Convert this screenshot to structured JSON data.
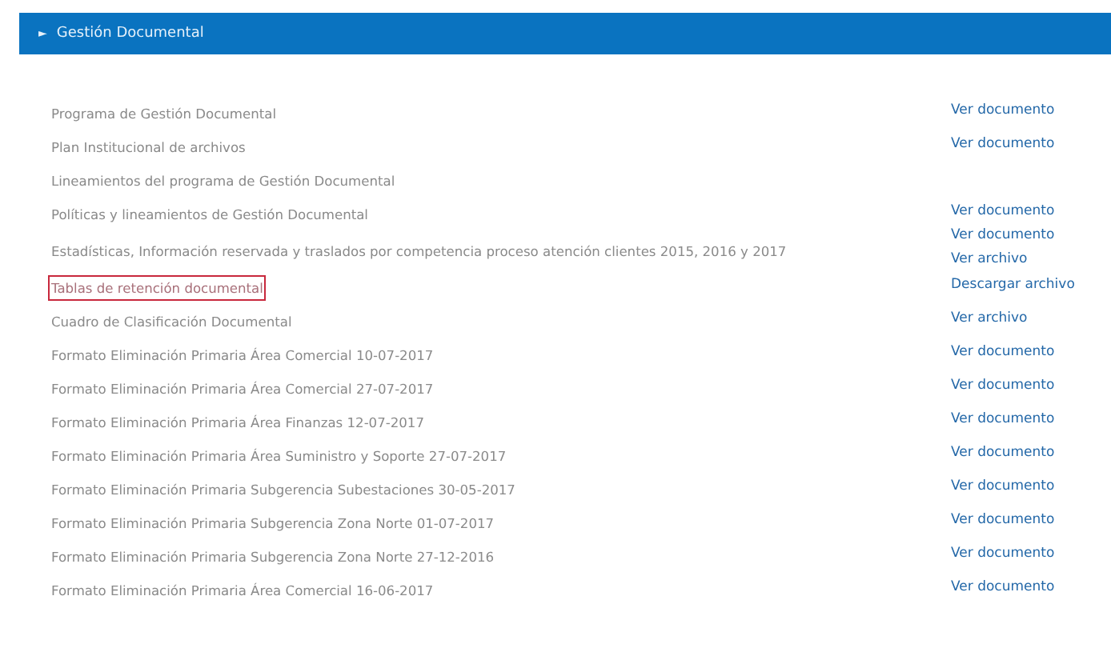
{
  "section": {
    "arrow": "►",
    "title": "Gestión Documental"
  },
  "rows": [
    {
      "name": "Programa de Gestión Documental",
      "highlighted": false,
      "links": [
        "Ver documento"
      ]
    },
    {
      "name": "Plan Institucional de archivos",
      "highlighted": false,
      "links": [
        "Ver documento"
      ]
    },
    {
      "name": "Lineamientos del programa de Gestión Documental",
      "highlighted": false,
      "links": []
    },
    {
      "name": "Políticas y lineamientos de Gestión Documental",
      "highlighted": false,
      "links": [
        "Ver documento"
      ]
    },
    {
      "name": "Estadísticas, Información reservada y traslados por competencia proceso atención clientes 2015, 2016 y 2017",
      "highlighted": false,
      "links": [
        "Ver documento",
        "Ver archivo"
      ]
    },
    {
      "name": "Tablas de retención documental",
      "highlighted": true,
      "links": [
        "Descargar archivo"
      ]
    },
    {
      "name": "Cuadro de Clasificación Documental",
      "highlighted": false,
      "links": [
        "Ver archivo"
      ]
    },
    {
      "name": "Formato Eliminación Primaria Área Comercial 10-07-2017",
      "highlighted": false,
      "links": [
        "Ver documento"
      ]
    },
    {
      "name": "Formato Eliminación Primaria Área Comercial 27-07-2017",
      "highlighted": false,
      "links": [
        "Ver documento"
      ]
    },
    {
      "name": "Formato Eliminación Primaria Área Finanzas 12-07-2017",
      "highlighted": false,
      "links": [
        "Ver documento"
      ]
    },
    {
      "name": "Formato Eliminación Primaria Área Suministro y Soporte 27-07-2017",
      "highlighted": false,
      "links": [
        "Ver documento"
      ]
    },
    {
      "name": "Formato Eliminación Primaria Subgerencia Subestaciones 30-05-2017",
      "highlighted": false,
      "links": [
        "Ver documento"
      ]
    },
    {
      "name": "Formato Eliminación Primaria Subgerencia Zona Norte 01-07-2017",
      "highlighted": false,
      "links": [
        "Ver documento"
      ]
    },
    {
      "name": "Formato Eliminación Primaria Subgerencia Zona Norte 27-12-2016",
      "highlighted": false,
      "links": [
        "Ver documento"
      ]
    },
    {
      "name": "Formato Eliminación Primaria Área Comercial 16-06-2017",
      "highlighted": false,
      "links": [
        "Ver documento"
      ]
    }
  ]
}
